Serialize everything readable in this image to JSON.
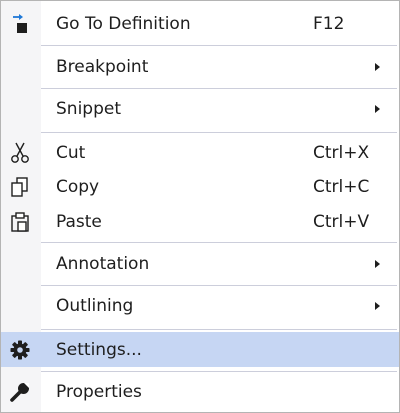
{
  "menu": {
    "items": [
      {
        "label": "Go To Definition",
        "shortcut": "F12",
        "icon": "go-to-definition-icon"
      },
      {
        "label": "Breakpoint",
        "submenu": true
      },
      {
        "label": "Snippet",
        "submenu": true
      },
      {
        "label": "Cut",
        "shortcut": "Ctrl+X",
        "icon": "scissors-icon"
      },
      {
        "label": "Copy",
        "shortcut": "Ctrl+C",
        "icon": "copy-icon"
      },
      {
        "label": "Paste",
        "shortcut": "Ctrl+V",
        "icon": "paste-icon"
      },
      {
        "label": "Annotation",
        "submenu": true
      },
      {
        "label": "Outlining",
        "submenu": true
      },
      {
        "label": "Settings...",
        "icon": "gear-icon",
        "highlighted": true
      },
      {
        "label": "Properties",
        "icon": "wrench-icon"
      }
    ]
  },
  "colors": {
    "highlight": "#c6d6f3",
    "gutter": "#f5f5f7",
    "separator": "#cccedb",
    "icon_accent": "#1e78d7",
    "text": "#1e1e1e"
  }
}
